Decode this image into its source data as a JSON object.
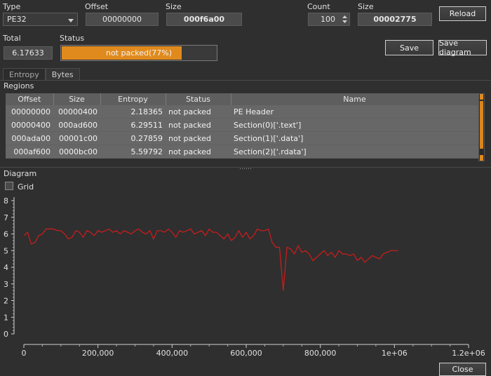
{
  "header": {
    "type_label": "Type",
    "type_value": "PE32",
    "offset_label": "Offset",
    "offset_value": "00000000",
    "size_label": "Size",
    "size_value": "000f6a00",
    "count_label": "Count",
    "count_value": "100",
    "size2_label": "Size",
    "size2_value": "00002775",
    "reload_label": "Reload",
    "total_label": "Total",
    "total_value": "6.17633",
    "status_label": "Status",
    "status_text": "not packed(77%)",
    "status_progress": 0.77,
    "save_label": "Save",
    "save_diagram_label": "Save diagram"
  },
  "tabs": [
    "Entropy",
    "Bytes"
  ],
  "regions": {
    "title": "Regions",
    "columns": [
      "Offset",
      "Size",
      "Entropy",
      "Status",
      "Name"
    ],
    "rows": [
      [
        "00000000",
        "00000400",
        "2.18365",
        "not packed",
        "PE Header"
      ],
      [
        "00000400",
        "000ad600",
        "6.29511",
        "not packed",
        "Section(0)['.text']"
      ],
      [
        "000ada00",
        "00001c00",
        "0.27859",
        "not packed",
        "Section(1)['.data']"
      ],
      [
        "000af600",
        "0000bc00",
        "5.59792",
        "not packed",
        "Section(2)['.rdata']"
      ]
    ]
  },
  "diagram": {
    "title": "Diagram",
    "grid_label": "Grid",
    "grid_checked": false
  },
  "close_label": "Close",
  "colors": {
    "accent": "#e08a1e",
    "line": "#d01c1c"
  },
  "chart_data": {
    "type": "line",
    "xlim": [
      0,
      1200000
    ],
    "ylim": [
      0,
      8
    ],
    "x_ticks": [
      0,
      200000,
      400000,
      600000,
      800000,
      1000000,
      1200000
    ],
    "x_tick_labels": [
      "0",
      "200,000",
      "400,000",
      "600,000",
      "800,000",
      "1e+06",
      "1.2e+06"
    ],
    "y_ticks": [
      0,
      1,
      2,
      3,
      4,
      5,
      6,
      7,
      8
    ],
    "y_tick_labels": [
      "0",
      "1",
      "2",
      "3",
      "4",
      "5",
      "6",
      "7",
      "8"
    ],
    "grid": false,
    "series": [
      {
        "x": [
          0,
          10000,
          20000,
          30000,
          40000,
          50000,
          60000,
          70000,
          80000,
          90000,
          100000,
          110000,
          120000,
          130000,
          140000,
          150000,
          160000,
          170000,
          180000,
          190000,
          200000,
          210000,
          220000,
          230000,
          240000,
          250000,
          260000,
          270000,
          280000,
          290000,
          300000,
          310000,
          320000,
          330000,
          340000,
          350000,
          360000,
          370000,
          380000,
          390000,
          400000,
          410000,
          420000,
          430000,
          440000,
          450000,
          460000,
          470000,
          480000,
          490000,
          500000,
          510000,
          520000,
          530000,
          540000,
          550000,
          560000,
          570000,
          580000,
          590000,
          600000,
          610000,
          620000,
          630000,
          640000,
          650000,
          660000,
          670000,
          680000,
          690000,
          700000,
          710000,
          720000,
          730000,
          740000,
          750000,
          760000,
          770000,
          780000,
          790000,
          800000,
          810000,
          820000,
          830000,
          840000,
          850000,
          860000,
          870000,
          880000,
          890000,
          900000,
          910000,
          920000,
          930000,
          940000,
          950000,
          960000,
          970000,
          980000,
          990000,
          1000000,
          1010000
        ],
        "y": [
          5.9,
          6.1,
          5.4,
          5.5,
          5.9,
          6.0,
          6.3,
          6.3,
          6.3,
          6.2,
          6.2,
          6.0,
          5.7,
          5.8,
          6.2,
          6.1,
          5.8,
          6.2,
          6.1,
          5.9,
          6.2,
          6.1,
          6.2,
          6.3,
          6.1,
          6.2,
          6.0,
          6.2,
          6.1,
          6.0,
          6.2,
          6.3,
          6.1,
          6.0,
          6.2,
          5.7,
          6.2,
          6.2,
          6.1,
          6.3,
          6.1,
          5.8,
          6.2,
          6.1,
          6.2,
          6.3,
          6.0,
          6.1,
          6.2,
          5.9,
          6.3,
          6.1,
          6.1,
          5.9,
          5.7,
          6.0,
          5.6,
          5.8,
          6.2,
          5.8,
          6.1,
          5.7,
          5.9,
          6.3,
          6.2,
          6.2,
          6.3,
          5.5,
          5.2,
          5.2,
          2.6,
          5.2,
          5.1,
          4.8,
          5.3,
          4.9,
          5.0,
          4.8,
          4.4,
          4.6,
          4.8,
          5.0,
          4.7,
          4.9,
          4.6,
          5.0,
          4.8,
          4.8,
          4.7,
          4.8,
          4.4,
          4.6,
          4.3,
          4.5,
          4.7,
          4.6,
          4.5,
          4.8,
          4.9,
          5.0,
          5.0,
          5.0
        ]
      }
    ]
  }
}
